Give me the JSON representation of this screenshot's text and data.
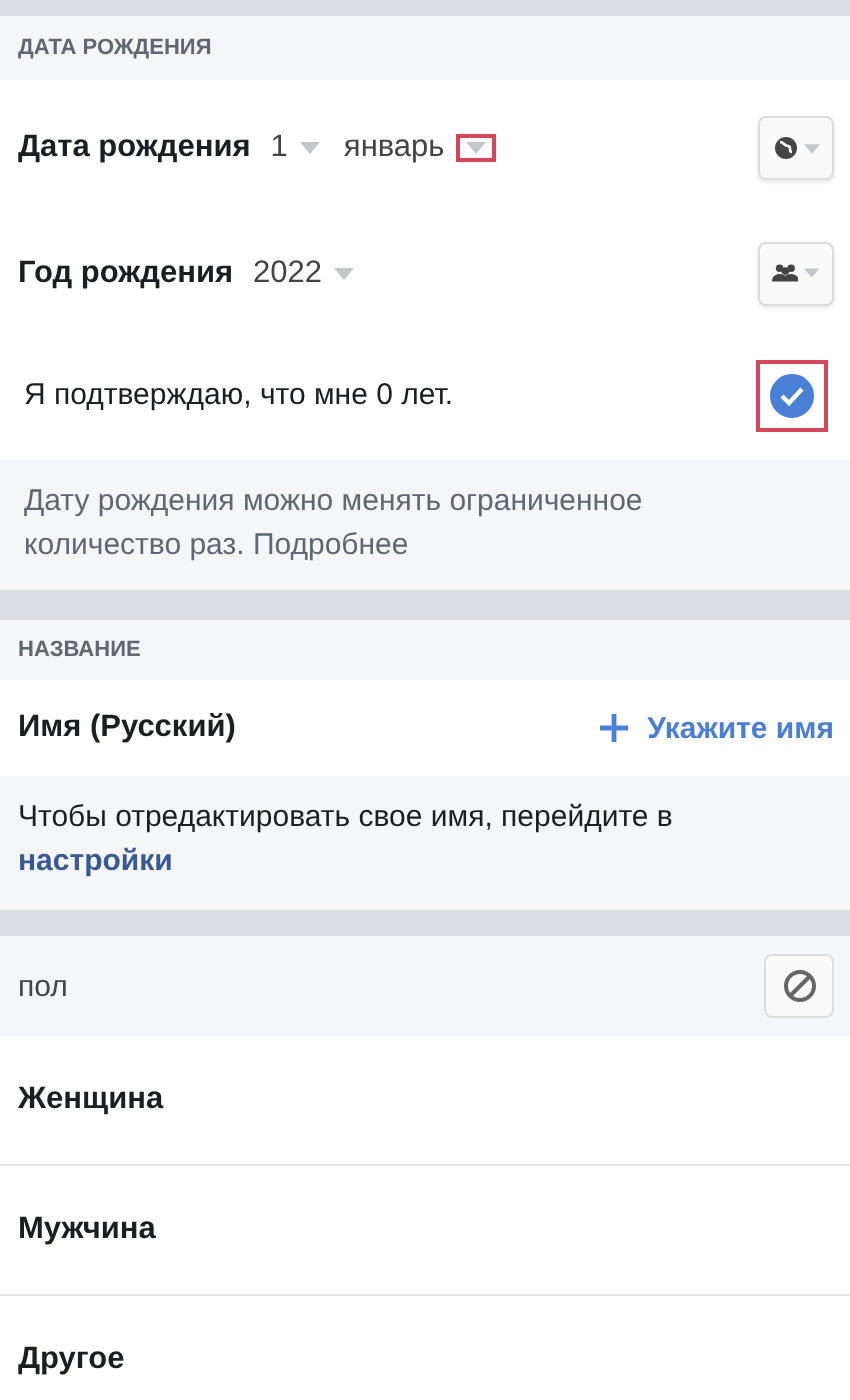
{
  "birthday_section": {
    "header": "ДАТА РОЖДЕНИЯ",
    "date_row": {
      "label": "Дата рождения",
      "day": "1",
      "month": "январь",
      "month_arrow_highlighted": true
    },
    "year_row": {
      "label": "Год рождения",
      "year": "2022"
    },
    "confirm": {
      "text": "Я подтверждаю, что мне 0 лет.",
      "checked": true,
      "highlighted": true
    },
    "note": "Дату рождения можно менять ограниченное количество раз.",
    "note_link": "Подробнее"
  },
  "name_section": {
    "header": "НАЗВАНИЕ",
    "label": "Имя (Русский)",
    "action": "Укажите имя",
    "note": "Чтобы отредактировать свое имя, перейдите в",
    "note_link": "настройки"
  },
  "gender_section": {
    "header": "пол",
    "options": [
      {
        "label": "Женщина"
      },
      {
        "label": "Мужчина"
      },
      {
        "label": "Другое"
      }
    ]
  }
}
